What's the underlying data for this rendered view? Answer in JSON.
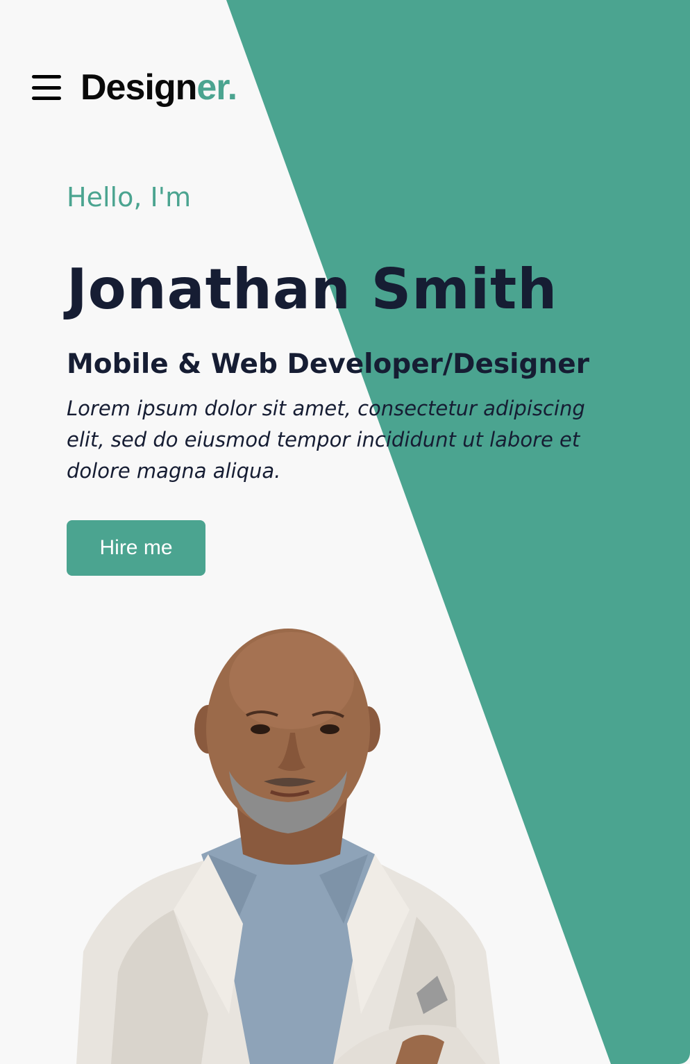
{
  "header": {
    "menu_icon": "hamburger-menu-icon",
    "logo_main": "Design",
    "logo_accent": "er."
  },
  "hero": {
    "greeting": "Hello, I'm",
    "name": "Jonathan Smith",
    "role": "Mobile & Web Developer/Designer",
    "bio": "Lorem ipsum dolor sit amet, consectetur adipiscing elit, sed do eiusmod tempor incididunt ut labore et dolore magna aliqua.",
    "cta_label": "Hire me"
  },
  "colors": {
    "accent": "#4ba490",
    "text_dark": "#161d33",
    "background": "#f8f8f8"
  }
}
